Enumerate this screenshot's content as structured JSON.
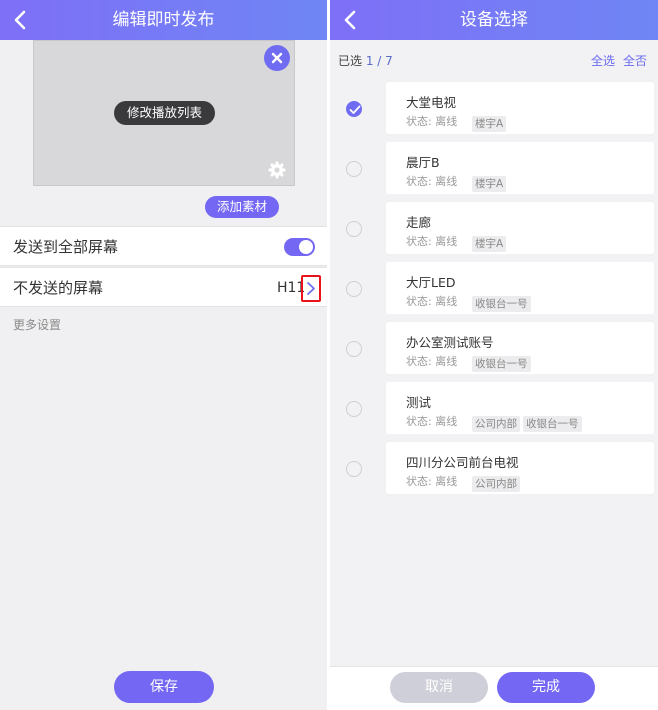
{
  "left": {
    "header": {
      "title": "编辑即时发布",
      "back_icon": "chevron-left-icon"
    },
    "preview": {
      "label": "修改播放列表",
      "close_icon": "close-icon",
      "settings_icon": "gear-icon"
    },
    "add_material_label": "添加素材",
    "send_all": {
      "label": "发送到全部屏幕",
      "toggle_on": true
    },
    "exclude_screens": {
      "label": "不发送的屏幕",
      "value": "H11",
      "chevron_icon": "chevron-right-icon"
    },
    "more_settings": "更多设置",
    "save_label": "保存"
  },
  "right": {
    "header": {
      "title": "设备选择",
      "back_icon": "chevron-left-icon"
    },
    "selection": {
      "prefix": "已选",
      "count": "1 / 7"
    },
    "select_all": "全选",
    "select_none": "全否",
    "devices": [
      {
        "name": "大堂电视",
        "status": "状态: 离线",
        "tags": [
          "楼宇A"
        ],
        "checked": true
      },
      {
        "name": "晨厅B",
        "status": "状态: 离线",
        "tags": [
          "楼宇A"
        ],
        "checked": false
      },
      {
        "name": "走廊",
        "status": "状态: 离线",
        "tags": [
          "楼宇A"
        ],
        "checked": false
      },
      {
        "name": "大厅LED",
        "status": "状态: 离线",
        "tags": [
          "收银台一号"
        ],
        "checked": false
      },
      {
        "name": "办公室测试账号",
        "status": "状态: 离线",
        "tags": [
          "收银台一号"
        ],
        "checked": false
      },
      {
        "name": "测试",
        "status": "状态: 离线",
        "tags": [
          "公司内部",
          "收银台一号"
        ],
        "checked": false
      },
      {
        "name": "四川分公司前台电视",
        "status": "状态: 离线",
        "tags": [
          "公司内部"
        ],
        "checked": false
      }
    ],
    "cancel_label": "取消",
    "done_label": "完成"
  },
  "colors": {
    "accent": "#7467f3",
    "header_gradient_start": "#7e6ff7",
    "header_gradient_end": "#6f86f4",
    "highlight_box": "#e8131b",
    "disabled_button": "#cfcfd9"
  }
}
